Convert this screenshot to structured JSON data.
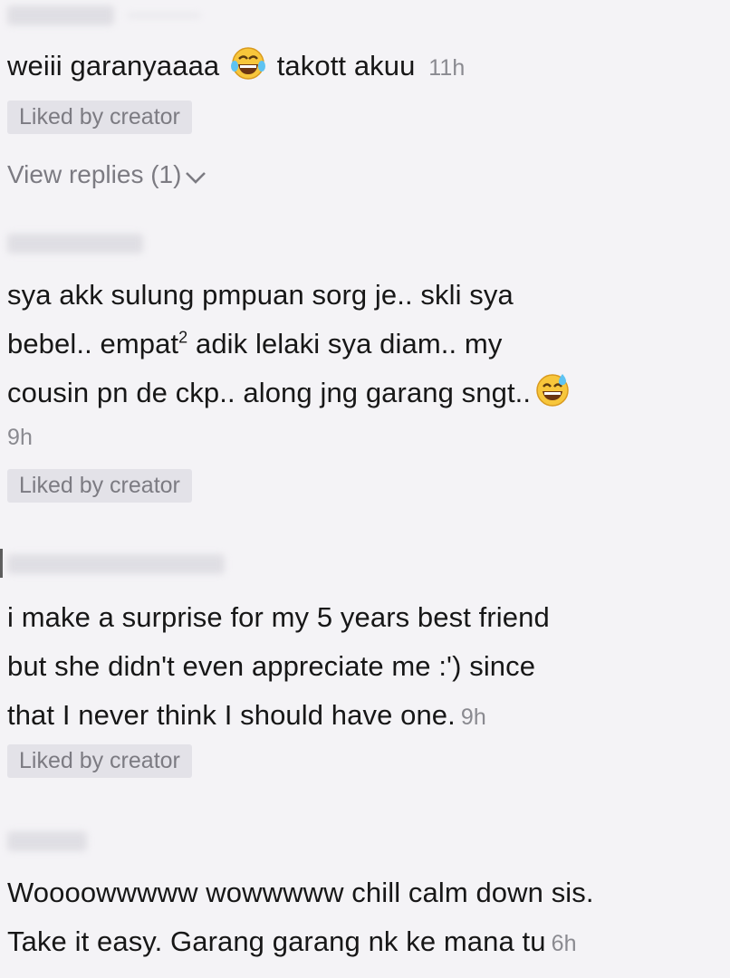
{
  "comments": [
    {
      "text_a": "weiii garanyaaaa",
      "emoji": "face-with-tears-of-joy-icon",
      "text_b": "takott akuu",
      "time": "11h",
      "badge": "Liked by creator",
      "replies": "View replies (1)"
    },
    {
      "line1": "sya akk sulung pmpuan sorg je.. skli sya",
      "line2_a": "bebel.. empat",
      "line2_sup": "2",
      "line2_b": " adik lelaki sya diam.. my",
      "line3": "cousin pn de ckp.. along jng garang sngt..",
      "emoji": "grinning-face-with-sweat-icon",
      "time": "9h",
      "badge": "Liked by creator"
    },
    {
      "line1": "i make a surprise for my 5 years best friend",
      "line2": "but she didn't even appreciate me :') since",
      "line3": "that I never think I should have one.",
      "time": "9h",
      "badge": "Liked by creator"
    },
    {
      "line1": "Woooowwwww wowwwww chill calm down sis.",
      "line2": "Take it easy. Garang garang nk ke mana tu",
      "time": "6h"
    }
  ]
}
